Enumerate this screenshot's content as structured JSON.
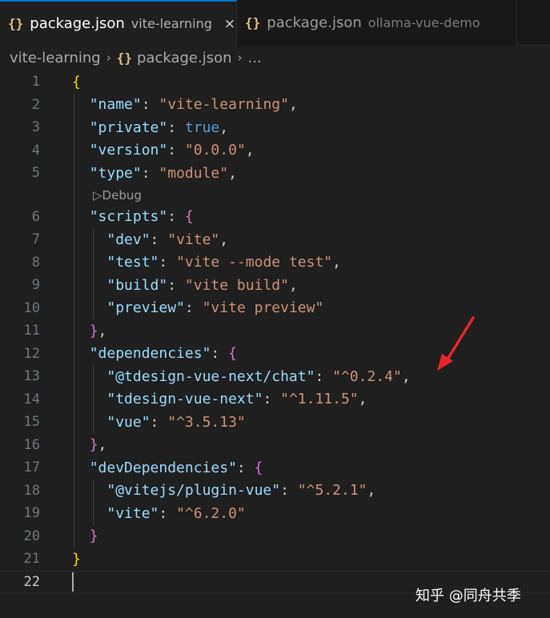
{
  "tabs": [
    {
      "icon": "{}",
      "title": "package.json",
      "description": "vite-learning",
      "close": "×"
    },
    {
      "icon": "{}",
      "title": "package.json",
      "description": "ollama-vue-demo"
    }
  ],
  "breadcrumb": {
    "folder": "vite-learning",
    "icon": "{}",
    "file": "package.json",
    "more": "...",
    "separator": "›"
  },
  "codelens": {
    "icon": "▷",
    "label": "Debug"
  },
  "lines": [
    {
      "n": "1",
      "tokens": [
        {
          "c": "p1",
          "t": "{"
        }
      ]
    },
    {
      "n": "2",
      "tokens": [
        {
          "c": "d",
          "t": "  "
        },
        {
          "c": "k",
          "t": "\"name\""
        },
        {
          "c": "d",
          "t": ": "
        },
        {
          "c": "s",
          "t": "\"vite-learning\""
        },
        {
          "c": "d",
          "t": ","
        }
      ]
    },
    {
      "n": "3",
      "tokens": [
        {
          "c": "d",
          "t": "  "
        },
        {
          "c": "k",
          "t": "\"private\""
        },
        {
          "c": "d",
          "t": ": "
        },
        {
          "c": "b",
          "t": "true"
        },
        {
          "c": "d",
          "t": ","
        }
      ]
    },
    {
      "n": "4",
      "tokens": [
        {
          "c": "d",
          "t": "  "
        },
        {
          "c": "k",
          "t": "\"version\""
        },
        {
          "c": "d",
          "t": ": "
        },
        {
          "c": "s",
          "t": "\"0.0.0\""
        },
        {
          "c": "d",
          "t": ","
        }
      ]
    },
    {
      "n": "5",
      "tokens": [
        {
          "c": "d",
          "t": "  "
        },
        {
          "c": "k",
          "t": "\"type\""
        },
        {
          "c": "d",
          "t": ": "
        },
        {
          "c": "s",
          "t": "\"module\""
        },
        {
          "c": "d",
          "t": ","
        }
      ]
    },
    {
      "n": "6",
      "tokens": [
        {
          "c": "d",
          "t": "  "
        },
        {
          "c": "k",
          "t": "\"scripts\""
        },
        {
          "c": "d",
          "t": ": "
        },
        {
          "c": "p2",
          "t": "{"
        }
      ]
    },
    {
      "n": "7",
      "tokens": [
        {
          "c": "d",
          "t": "    "
        },
        {
          "c": "k",
          "t": "\"dev\""
        },
        {
          "c": "d",
          "t": ": "
        },
        {
          "c": "s",
          "t": "\"vite\""
        },
        {
          "c": "d",
          "t": ","
        }
      ]
    },
    {
      "n": "8",
      "tokens": [
        {
          "c": "d",
          "t": "    "
        },
        {
          "c": "k",
          "t": "\"test\""
        },
        {
          "c": "d",
          "t": ": "
        },
        {
          "c": "s",
          "t": "\"vite --mode test\""
        },
        {
          "c": "d",
          "t": ","
        }
      ]
    },
    {
      "n": "9",
      "tokens": [
        {
          "c": "d",
          "t": "    "
        },
        {
          "c": "k",
          "t": "\"build\""
        },
        {
          "c": "d",
          "t": ": "
        },
        {
          "c": "s",
          "t": "\"vite build\""
        },
        {
          "c": "d",
          "t": ","
        }
      ]
    },
    {
      "n": "10",
      "tokens": [
        {
          "c": "d",
          "t": "    "
        },
        {
          "c": "k",
          "t": "\"preview\""
        },
        {
          "c": "d",
          "t": ": "
        },
        {
          "c": "s",
          "t": "\"vite preview\""
        }
      ]
    },
    {
      "n": "11",
      "tokens": [
        {
          "c": "d",
          "t": "  "
        },
        {
          "c": "p2",
          "t": "}"
        },
        {
          "c": "d",
          "t": ","
        }
      ]
    },
    {
      "n": "12",
      "tokens": [
        {
          "c": "d",
          "t": "  "
        },
        {
          "c": "k",
          "t": "\"dependencies\""
        },
        {
          "c": "d",
          "t": ": "
        },
        {
          "c": "p2",
          "t": "{"
        }
      ]
    },
    {
      "n": "13",
      "tokens": [
        {
          "c": "d",
          "t": "    "
        },
        {
          "c": "k",
          "t": "\"@tdesign-vue-next/chat\""
        },
        {
          "c": "d",
          "t": ": "
        },
        {
          "c": "s",
          "t": "\"^0.2.4\""
        },
        {
          "c": "d",
          "t": ","
        }
      ]
    },
    {
      "n": "14",
      "tokens": [
        {
          "c": "d",
          "t": "    "
        },
        {
          "c": "k",
          "t": "\"tdesign-vue-next\""
        },
        {
          "c": "d",
          "t": ": "
        },
        {
          "c": "s",
          "t": "\"^1.11.5\""
        },
        {
          "c": "d",
          "t": ","
        }
      ]
    },
    {
      "n": "15",
      "tokens": [
        {
          "c": "d",
          "t": "    "
        },
        {
          "c": "k",
          "t": "\"vue\""
        },
        {
          "c": "d",
          "t": ": "
        },
        {
          "c": "s",
          "t": "\"^3.5.13\""
        }
      ]
    },
    {
      "n": "16",
      "tokens": [
        {
          "c": "d",
          "t": "  "
        },
        {
          "c": "p2",
          "t": "}"
        },
        {
          "c": "d",
          "t": ","
        }
      ]
    },
    {
      "n": "17",
      "tokens": [
        {
          "c": "d",
          "t": "  "
        },
        {
          "c": "k",
          "t": "\"devDependencies\""
        },
        {
          "c": "d",
          "t": ": "
        },
        {
          "c": "p2",
          "t": "{"
        }
      ]
    },
    {
      "n": "18",
      "tokens": [
        {
          "c": "d",
          "t": "    "
        },
        {
          "c": "k",
          "t": "\"@vitejs/plugin-vue\""
        },
        {
          "c": "d",
          "t": ": "
        },
        {
          "c": "s",
          "t": "\"^5.2.1\""
        },
        {
          "c": "d",
          "t": ","
        }
      ]
    },
    {
      "n": "19",
      "tokens": [
        {
          "c": "d",
          "t": "    "
        },
        {
          "c": "k",
          "t": "\"vite\""
        },
        {
          "c": "d",
          "t": ": "
        },
        {
          "c": "s",
          "t": "\"^6.2.0\""
        }
      ]
    },
    {
      "n": "20",
      "tokens": [
        {
          "c": "d",
          "t": "  "
        },
        {
          "c": "p2",
          "t": "}"
        }
      ]
    },
    {
      "n": "21",
      "tokens": [
        {
          "c": "p1",
          "t": "}"
        }
      ]
    },
    {
      "n": "22",
      "tokens": []
    }
  ],
  "annotation": {
    "arrow_color": "#e8262b"
  },
  "watermark": "知乎 @同舟共季",
  "colors": {
    "accent": "#0078d4",
    "string": "#ce9178",
    "key": "#9cdcfe",
    "boolean": "#569cd6",
    "bracket_level1": "#ffd700",
    "bracket_level2": "#da70d6",
    "json_icon": "#e2c08d"
  }
}
